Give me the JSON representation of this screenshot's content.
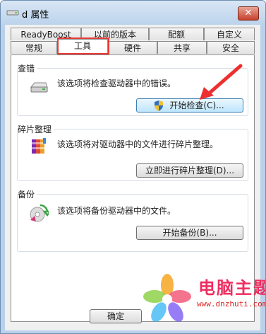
{
  "window": {
    "title": "d 属性",
    "close_symbol": "✕"
  },
  "tabs_row1": [
    {
      "label": "ReadyBoost"
    },
    {
      "label": "以前的版本"
    },
    {
      "label": "配额"
    },
    {
      "label": "自定义"
    }
  ],
  "tabs_row2": [
    {
      "label": "常规"
    },
    {
      "label": "工具",
      "selected": true
    },
    {
      "label": "硬件"
    },
    {
      "label": "共享"
    },
    {
      "label": "安全"
    }
  ],
  "groups": {
    "check": {
      "title": "查错",
      "description": "该选项将检查驱动器中的错误。",
      "button": "开始检查(C)...",
      "icon": "drive-icon"
    },
    "defrag": {
      "title": "碎片整理",
      "description": "该选项将对驱动器中的文件进行碎片整理。",
      "button": "立即进行碎片整理(D)...",
      "icon": "defrag-icon"
    },
    "backup": {
      "title": "备份",
      "description": "该选项将备份驱动器中的文件。",
      "button": "开始备份(B)...",
      "icon": "backup-icon"
    }
  },
  "footer": {
    "ok": "确定"
  },
  "watermark": {
    "title": "电脑主题",
    "url": "www.dnzhuti.com"
  },
  "colors": {
    "highlight_red": "#e53a35",
    "accent_blue": "#3c7fb1"
  }
}
